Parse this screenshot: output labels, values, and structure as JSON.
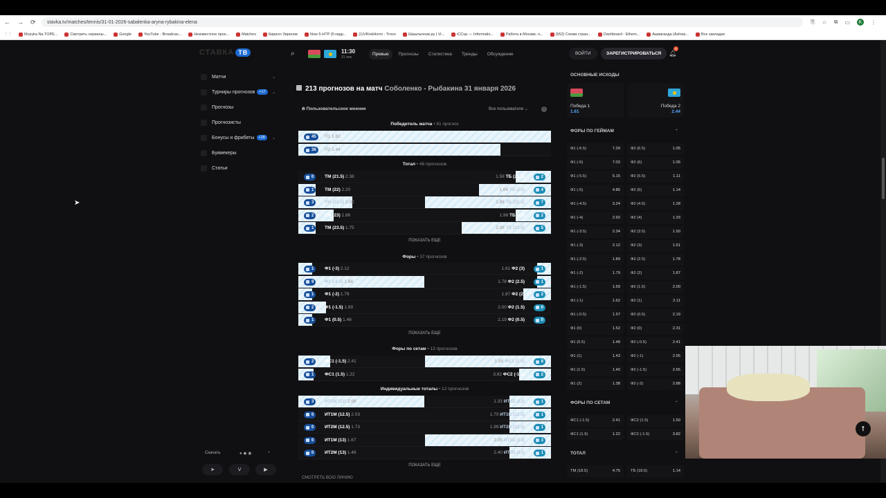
{
  "browser": {
    "url": "stavka.tv/matches/tennis/31-01-2026-sabalenka-aryna-rybakina-elena",
    "bookmarks": [
      "Muzyka Na TOPE...",
      "Смотреть сериалы...",
      "Google",
      "YouTube - Broadcas...",
      "Неизвестное прох...",
      "Matches",
      "Кирилл Зиренов",
      "Now 5-HTP (5-гидр...",
      "(1)VKinkHorro - Trovo",
      "Шашлычник.ру | Vi...",
      "iCCup — Informatio...",
      "Работа в Москве, п...",
      "(552) Схема стран...",
      "Dashboard - Ethem...",
      "Ашваганда (Ashwa...",
      "Все закладки"
    ],
    "profile_initial": "K"
  },
  "header": {
    "logo": "СТАВКА",
    "logo_tv": "ТВ",
    "time": "11:30",
    "date": "31 янв",
    "nav": [
      "Превью",
      "Прогнозы",
      "Статистика",
      "Тренды",
      "Обсуждение"
    ],
    "login": "ВОЙТИ",
    "register": "ЗАРЕГИСТРИРОВАТЬСЯ",
    "notif_count": "8"
  },
  "sidebar": {
    "items": [
      {
        "label": "Матчи",
        "badge": "",
        "chev": "⌄"
      },
      {
        "label": "Турниры прогнозов",
        "badge": "+17",
        "chev": "⌄"
      },
      {
        "label": "Прогнозы",
        "badge": "",
        "chev": ""
      },
      {
        "label": "Прогнозисты",
        "badge": "",
        "chev": ""
      },
      {
        "label": "Бонусы и фрибеты",
        "badge": "+28",
        "chev": "⌄"
      },
      {
        "label": "Букмекеры",
        "badge": "",
        "chev": ""
      },
      {
        "label": "Статьи",
        "badge": "",
        "chev": ""
      }
    ],
    "download": "Скачать"
  },
  "main": {
    "title_count": "213 прогнозов на матч",
    "title_match": "Соболенко - Рыбакина 31 января 2026",
    "opinion": "Пользовательское мнение",
    "filter": "Все пользователи",
    "show_more": "ПОКАЗАТЬ ЕЩЕ",
    "see_all": "СМОТРЕТЬ ВСЮ ЛИНИЮ",
    "sections": [
      {
        "title": "Победитель матча",
        "count": "81 прогноз"
      },
      {
        "title": "Тотал",
        "count": "46 прогнозов"
      },
      {
        "title": "Форы",
        "count": "37 прогнозов"
      },
      {
        "title": "Форы по сетам",
        "count": "13 прогнозов"
      },
      {
        "title": "Индивидуальные тоталы",
        "count": "12 прогнозов"
      }
    ],
    "winner_rows": [
      {
        "n": "45",
        "label": "П1",
        "odd": "1.61",
        "pct": 1.0
      },
      {
        "n": "36",
        "label": "П2",
        "odd": "2.44",
        "pct": 0.8
      }
    ],
    "total_rows": [
      {
        "ln": "0",
        "ll": "ТМ (21.5)",
        "lo": "2.38",
        "lp": 0,
        "rn": "2",
        "rl": "ТБ (21.5)",
        "ro": "1.58",
        "rp": 0.28
      },
      {
        "ln": "1",
        "ll": "ТМ (22)",
        "lo": "2.20",
        "lp": 0.14,
        "rn": "4",
        "rl": "ТБ (22)",
        "ro": "1.66",
        "rp": 0.57
      },
      {
        "ln": "3",
        "ll": "ТМ (22.5)",
        "lo": "2.00",
        "lp": 0.43,
        "rn": "7",
        "rl": "ТБ (22.5)",
        "ro": "1.88",
        "rp": 1.0
      },
      {
        "ln": "2",
        "ll": "ТМ (23)",
        "lo": "1.86",
        "lp": 0.28,
        "rn": "2",
        "rl": "ТБ (23)",
        "ro": "1.98",
        "rp": 0.28
      },
      {
        "ln": "1",
        "ll": "ТМ (23.5)",
        "lo": "1.75",
        "lp": 0.14,
        "rn": "5",
        "rl": "ТБ (23.5)",
        "ro": "2.08",
        "rp": 0.71
      }
    ],
    "fora_rows": [
      {
        "ln": "1",
        "ll": "Ф1 (-3)",
        "lo": "2.12",
        "lp": 0.11,
        "rn": "1",
        "rl": "Ф2 (3)",
        "ro": "1.61",
        "rp": 0.11
      },
      {
        "ln": "9",
        "ll": "Ф1 (-2.5)",
        "lo": "1.88",
        "lp": 1.0,
        "rn": "1",
        "rl": "Ф2 (2.5)",
        "ro": "1.78",
        "rp": 0.11
      },
      {
        "ln": "1",
        "ll": "Ф1 (-2)",
        "lo": "1.79",
        "lp": 0.11,
        "rn": "2",
        "rl": "Ф2 (2)",
        "ro": "1.87",
        "rp": 0.22
      },
      {
        "ln": "2",
        "ll": "Ф1 (-1.5)",
        "lo": "1.69",
        "lp": 0.22,
        "rn": "0",
        "rl": "Ф2 (1.5)",
        "ro": "2.00",
        "rp": 0
      },
      {
        "ln": "1",
        "ll": "Ф1 (0.5)",
        "lo": "1.48",
        "lp": 0.11,
        "rn": "0",
        "rl": "Ф2 (0.5)",
        "ro": "2.19",
        "rp": 0
      }
    ],
    "set_rows": [
      {
        "ln": "2",
        "ll": "ФС1 (-1.5)",
        "lo": "2.41",
        "lp": 0.25,
        "rn": "8",
        "rl": "ФС2 (1.5)",
        "ro": "1.50",
        "rp": 1.0
      },
      {
        "ln": "1",
        "ll": "ФС1 (1.5)",
        "lo": "1.22",
        "lp": 0.12,
        "rn": "2",
        "rl": "ФС2 (-1.5)",
        "ro": "3.82",
        "rp": 0.25
      }
    ],
    "ind_rows": [
      {
        "ln": "3",
        "ll": "ИТ1М (12)",
        "lo": "2.98",
        "lp": 1.0,
        "rn": "1",
        "rl": "ИТ1Б (12)",
        "ro": "1.33",
        "rp": 0.33
      },
      {
        "ln": "0",
        "ll": "ИТ1М (12.5)",
        "lo": "2.03",
        "lp": 0,
        "rn": "1",
        "rl": "ИТ1Б (12.5)",
        "ro": "1.70",
        "rp": 0.33
      },
      {
        "ln": "0",
        "ll": "ИТ2М (12.5)",
        "lo": "1.73",
        "lp": 0,
        "rn": "1",
        "rl": "ИТ2Б (12.5)",
        "ro": "1.99",
        "rp": 0.33
      },
      {
        "ln": "0",
        "ll": "ИТ1М (13)",
        "lo": "1.67",
        "lp": 0,
        "rn": "3",
        "rl": "ИТ1Б (13)",
        "ro": "2.05",
        "rp": 1.0
      },
      {
        "ln": "0",
        "ll": "ИТ2М (13)",
        "lo": "1.48",
        "lp": 0,
        "rn": "1",
        "rl": "ИТ2Б (13)",
        "ro": "2.40",
        "rp": 0.33
      }
    ]
  },
  "right": {
    "outcomes_title": "ОСНОВНЫЕ ИСХОДЫ",
    "win1_label": "Победа 1",
    "win1_odd": "1.61",
    "win2_label": "Победа 2",
    "win2_odd": "2.44",
    "games_title": "ФОРЫ ПО ГЕЙМАМ",
    "games": [
      [
        "Ф1 (-6.5)",
        "7.29",
        "Ф2 (6.5)",
        "1.05"
      ],
      [
        "Ф1 (-6)",
        "7.03",
        "Ф2 (6)",
        "1.05"
      ],
      [
        "Ф1 (-5.5)",
        "5.15",
        "Ф2 (5.5)",
        "1.11"
      ],
      [
        "Ф1 (-5)",
        "4.85",
        "Ф2 (5)",
        "1.14"
      ],
      [
        "Ф1 (-4.5)",
        "3.24",
        "Ф2 (4.5)",
        "1.28"
      ],
      [
        "Ф1 (-4)",
        "2.92",
        "Ф2 (4)",
        "1.33"
      ],
      [
        "Ф1 (-3.5)",
        "2.34",
        "Ф2 (3.5)",
        "1.50"
      ],
      [
        "Ф1 (-3)",
        "2.12",
        "Ф2 (3)",
        "1.61"
      ],
      [
        "Ф1 (-2.5)",
        "1.89",
        "Ф2 (2.5)",
        "1.78"
      ],
      [
        "Ф1 (-2)",
        "1.79",
        "Ф2 (2)",
        "1.87"
      ],
      [
        "Ф1 (-1.5)",
        "1.69",
        "Ф2 (1.5)",
        "2.00"
      ],
      [
        "Ф1 (-1)",
        "1.62",
        "Ф2 (1)",
        "2.11"
      ],
      [
        "Ф1 (-0.5)",
        "1.57",
        "Ф2 (0.5)",
        "2.19"
      ],
      [
        "Ф1 (0)",
        "1.52",
        "Ф2 (0)",
        "2.31"
      ],
      [
        "Ф1 (0.5)",
        "1.48",
        "Ф2 (-0.5)",
        "2.41"
      ],
      [
        "Ф1 (1)",
        "1.43",
        "Ф2 (-1)",
        "2.55"
      ],
      [
        "Ф1 (1.5)",
        "1.40",
        "Ф2 (-1.5)",
        "2.65"
      ],
      [
        "Ф1 (2)",
        "1.38",
        "Ф2 (-2)",
        "2.88"
      ]
    ],
    "sets_title": "ФОРЫ ПО СЕТАМ",
    "sets": [
      [
        "ФС1 (-1.5)",
        "2.41",
        "ФС2 (1.5)",
        "1.50"
      ],
      [
        "ФС1 (1.5)",
        "1.22",
        "ФС2 (-1.5)",
        "3.82"
      ]
    ],
    "total_title": "ТОТАЛ",
    "total": [
      [
        "ТМ (18.5)",
        "4.75",
        "ТБ (18.5)",
        "1.14"
      ]
    ]
  }
}
